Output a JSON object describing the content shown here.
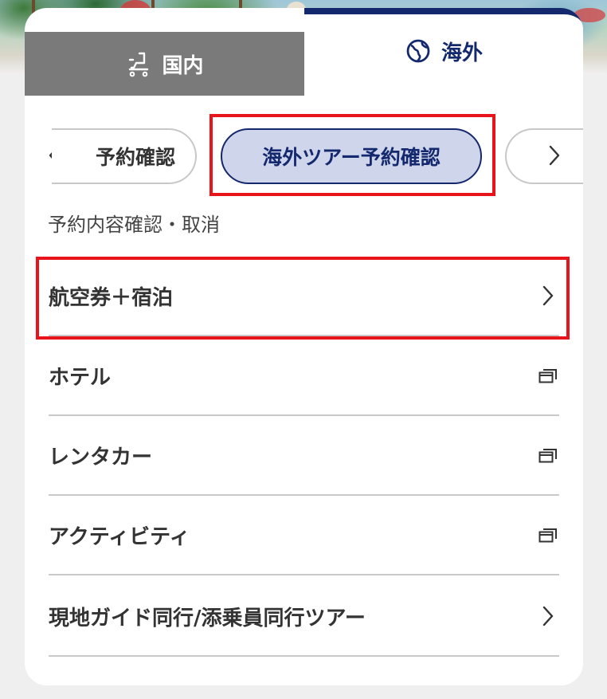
{
  "tabs": {
    "domestic": {
      "label": "国内",
      "icon": "airline-seat-icon"
    },
    "overseas": {
      "label": "海外",
      "icon": "globe-icon",
      "active": true
    }
  },
  "chips": [
    {
      "label": "予約確認",
      "active": false
    },
    {
      "label": "海外ツアー予約確認",
      "active": true
    },
    {
      "label": "",
      "active": false
    }
  ],
  "section_label": "予約内容確認・取消",
  "menu_items": [
    {
      "label": "航空券＋宿泊",
      "icon": "chevron-right-icon"
    },
    {
      "label": "ホテル",
      "icon": "external-window-icon"
    },
    {
      "label": "レンタカー",
      "icon": "external-window-icon"
    },
    {
      "label": "アクティビティ",
      "icon": "external-window-icon"
    },
    {
      "label": "現地ガイド同行/添乗員同行ツアー",
      "icon": "chevron-right-icon"
    }
  ],
  "colors": {
    "brand_navy": "#14286e",
    "active_chip_bg": "#cfd6ec",
    "inactive_tab_bg": "#7a7a7a",
    "highlight_red": "#e8141c"
  }
}
